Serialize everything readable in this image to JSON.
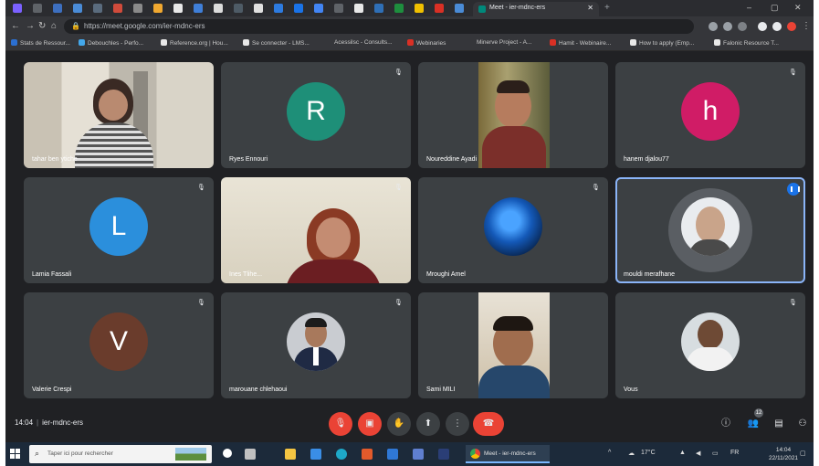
{
  "browser": {
    "active_tab_title": "Meet - ier-mdnc-ers",
    "url": "https://meet.google.com/ier-mdnc-ers",
    "bookmarks": [
      "Stats de Ressour...",
      "Debouchles - Perfo...",
      "Reference.org | Hou...",
      "Se connecter - LMS...",
      "Acessilsc - Consults...",
      "Webinaries",
      "Minerve Project - A...",
      "Hamit - Webinaire...",
      "How to apply (Emp...",
      "Falonic Resource T..."
    ]
  },
  "meeting": {
    "participants": [
      {
        "name": "tahar ben ytiche",
        "type": "video"
      },
      {
        "name": "Ryes Ennouri",
        "type": "letter",
        "initial": "R",
        "color": "#1e8f78"
      },
      {
        "name": "Noureddine Ayadi",
        "type": "video"
      },
      {
        "name": "hanem djalou77",
        "type": "letter",
        "initial": "h",
        "color": "#d01c66"
      },
      {
        "name": "Lamia Fassali",
        "type": "letter",
        "initial": "L",
        "color": "#2b8fdc"
      },
      {
        "name": "Ines Tlihe...",
        "type": "video"
      },
      {
        "name": "Mroughi Amel",
        "type": "photo-avatar"
      },
      {
        "name": "mouldi merafhane",
        "type": "photo-avatar",
        "speaking": true
      },
      {
        "name": "Valerie Crespi",
        "type": "letter",
        "initial": "V",
        "color": "#6a3c2c"
      },
      {
        "name": "marouane chlehaoui",
        "type": "photo-avatar"
      },
      {
        "name": "Sami MILI",
        "type": "video"
      },
      {
        "name": "Vous",
        "type": "photo-avatar"
      }
    ],
    "time": "14:04",
    "meeting_code": "ier-mdnc-ers",
    "participant_count": "12"
  },
  "taskbar": {
    "search_placeholder": "Taper ici pour rechercher",
    "chrome_task_label": "Meet - ier-mdnc-ers",
    "weather": "17°C",
    "clock_time": "14:04",
    "clock_date": "22/11/2021"
  },
  "colors": {
    "meet_bg": "#202124",
    "tile_bg": "#3c4043",
    "accent_red": "#ea4335",
    "speaking_outline": "#8ab4f8"
  }
}
